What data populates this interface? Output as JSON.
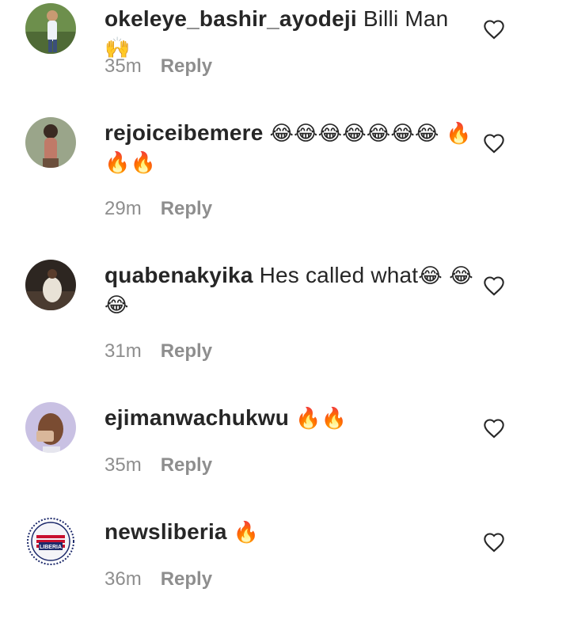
{
  "comments": [
    {
      "username": "okeleye_bashir_ayodeji",
      "text": "Billi Man ",
      "emoji": "🙌",
      "time": "35m",
      "reply": "Reply"
    },
    {
      "username": "rejoiceibemere",
      "text": "",
      "emoji": "😂😂😂😂😂😂😂 🔥🔥🔥",
      "time": "29m",
      "reply": "Reply"
    },
    {
      "username": "quabenakyika",
      "text": "Hes called what",
      "emoji": "😂 😂😂",
      "time": "31m",
      "reply": "Reply"
    },
    {
      "username": "ejimanwachukwu",
      "text": "",
      "emoji": "🔥🔥",
      "time": "35m",
      "reply": "Reply"
    },
    {
      "username": "newsliberia",
      "text": "",
      "emoji": "🔥",
      "time": "36m",
      "reply": "Reply"
    }
  ],
  "avatar_badge_text": "LIBERIA",
  "icons": {
    "like": "heart-outline-icon"
  }
}
